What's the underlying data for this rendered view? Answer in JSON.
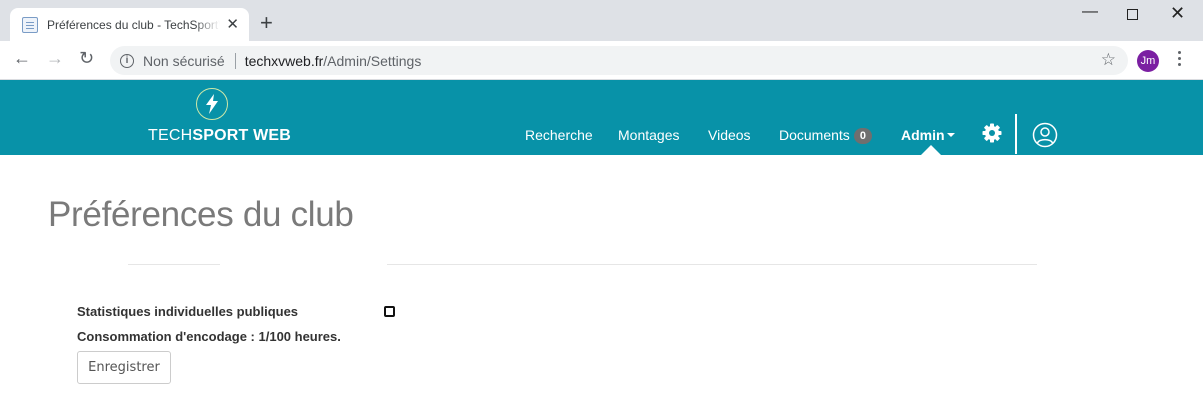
{
  "browser": {
    "tab_title": "Préférences du club - TechSportWeb",
    "tab_close": "✕",
    "new_tab": "+",
    "window_min": "—",
    "window_close": "✕",
    "nav_back": "←",
    "nav_forward": "→",
    "nav_reload": "↻",
    "security_label": "Non sécurisé",
    "url_host": "techxvweb.fr",
    "url_path": "/Admin/Settings",
    "bookmark_star": "☆",
    "profile_initials": "Jm"
  },
  "header": {
    "logo_text_light": "TECH",
    "logo_text_bold": "SPORT WEB",
    "nav": {
      "search": "Recherche",
      "montages": "Montages",
      "videos": "Videos",
      "documents": "Documents",
      "documents_count": "0",
      "admin": "Admin"
    },
    "colors": {
      "header_bg": "#0892a8",
      "badge_bg": "#6f6f6f"
    }
  },
  "content": {
    "page_title": "Préférences du club",
    "public_stats_label": "Statistiques individuelles publiques",
    "public_stats_checked": false,
    "encoding_usage": "Consommation d'encodage : 1/100 heures.",
    "save_label": "Enregistrer"
  }
}
